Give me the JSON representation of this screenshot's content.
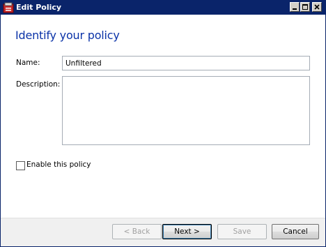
{
  "window": {
    "title": "Edit Policy",
    "accent_color": "#0a246a"
  },
  "page": {
    "heading": "Identify your policy",
    "heading_color": "#0b33a8"
  },
  "form": {
    "name_label": "Name:",
    "name_value": "Unfiltered",
    "description_label": "Description:",
    "description_value": "",
    "enable_label": "Enable this policy",
    "enable_checked": false
  },
  "buttons": {
    "back": "< Back",
    "next": "Next >",
    "save": "Save",
    "cancel": "Cancel"
  },
  "icons": {
    "app": "policy-app-icon",
    "minimize": "minimize-icon",
    "maximize": "maximize-icon",
    "close": "close-icon"
  }
}
